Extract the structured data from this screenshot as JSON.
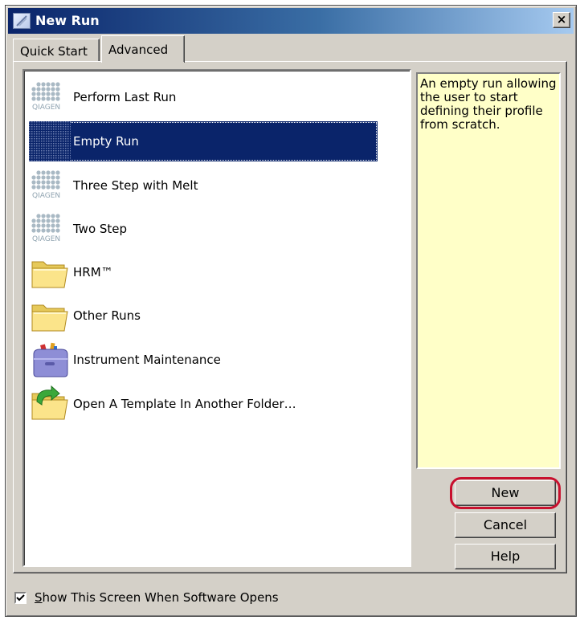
{
  "window": {
    "title": "New Run",
    "close_glyph": "×"
  },
  "tabs": [
    {
      "label": "Quick Start",
      "active": false
    },
    {
      "label": "Advanced",
      "active": true
    }
  ],
  "templates": [
    {
      "label": "Perform Last Run",
      "icon": "qiagen-logo-icon",
      "selected": false
    },
    {
      "label": "Empty Run",
      "icon": "qiagen-logo-icon",
      "selected": true
    },
    {
      "label": "Three Step with Melt",
      "icon": "qiagen-logo-icon",
      "selected": false
    },
    {
      "label": "Two Step",
      "icon": "qiagen-logo-icon",
      "selected": false
    },
    {
      "label": "HRM™",
      "icon": "folder-icon",
      "selected": false
    },
    {
      "label": "Other Runs",
      "icon": "folder-icon",
      "selected": false
    },
    {
      "label": "Instrument Maintenance",
      "icon": "toolbox-icon",
      "selected": false
    },
    {
      "label": "Open A Template In Another Folder…",
      "icon": "folder-open-arrow-icon",
      "selected": false
    }
  ],
  "qiagen_logo_text": "QIAGEN",
  "description": "An empty run allowing the user to start defining their profile from scratch.",
  "buttons": {
    "new": "New",
    "cancel": "Cancel",
    "help": "Help"
  },
  "show_on_open": {
    "label": "Show This Screen When Software Opens",
    "checked": true
  },
  "colors": {
    "selection": "#0a246a",
    "description_bg": "#ffffc8",
    "highlight_ring": "#c8102e",
    "dialog_face": "#d4d0c8"
  }
}
